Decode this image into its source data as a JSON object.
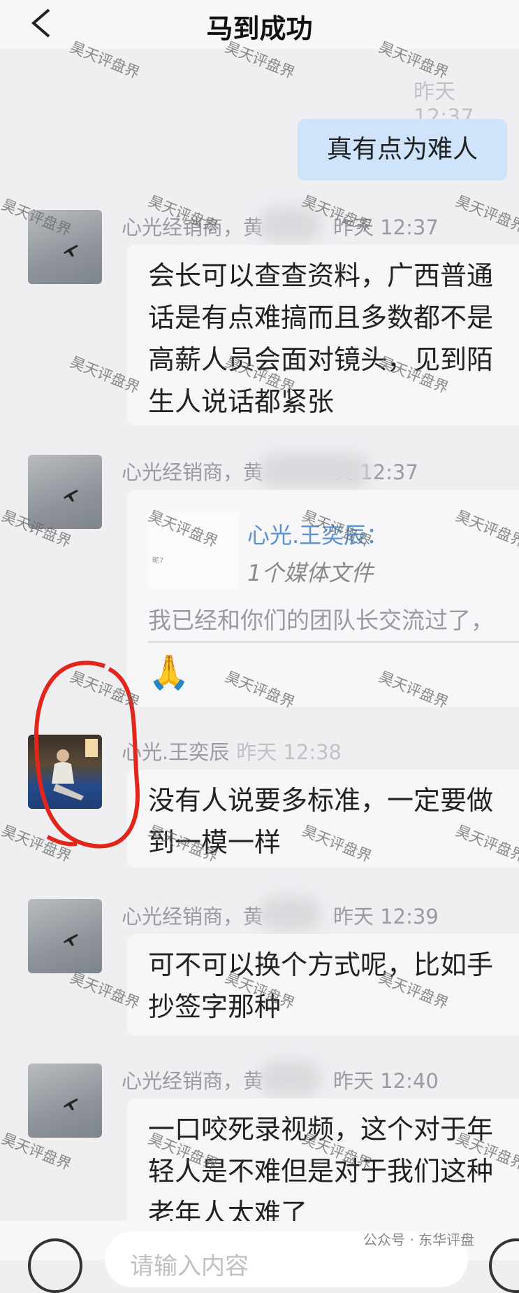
{
  "header": {
    "title": "马到成功",
    "back_icon": "chevron-left-icon"
  },
  "watermark": "昊天评盘界",
  "messages": [
    {
      "time": "昨天 12:37",
      "text": "真有点为难人"
    },
    {
      "sender": "心光经销商，黄",
      "time": "昨天 12:37",
      "text": "会长可以查查资料，广西普通\n话是有点难搞而且多数都不是\n高薪人员会面对镜头，见到陌\n生人说话都紧张"
    },
    {
      "sender": "心光经销商，黄",
      "time": "天 12:37",
      "quote_name": "心光.王奕辰：",
      "quote_media": "1个媒体文件",
      "thumb_label": "昵7",
      "quote_text": "我已经和你们的团队长交流过了，",
      "emoji": "🙏"
    },
    {
      "sender": "心光.王奕辰",
      "time": "昨天 12:38",
      "text": "没有人说要多标准，一定要做\n到一模一样"
    },
    {
      "sender": "心光经销商，黄",
      "time": "昨天 12:39",
      "text": "可不可以换个方式呢，比如手\n抄签字那种"
    },
    {
      "sender": "心光经销商，黄",
      "time": "昨天 12:40",
      "text": "一口咬死录视频，这个对于年\n轻人是不难但是对于我们这种\n老年人太难了"
    }
  ],
  "input": {
    "placeholder": "请输入内容"
  },
  "footer_tag": "公众号 · 东华评盘",
  "colors": {
    "my_bubble": "#cfe4fb",
    "other_bubble": "#f7f7f9",
    "quote_name": "#5a93d6",
    "highlight_circle": "#e3261b"
  }
}
